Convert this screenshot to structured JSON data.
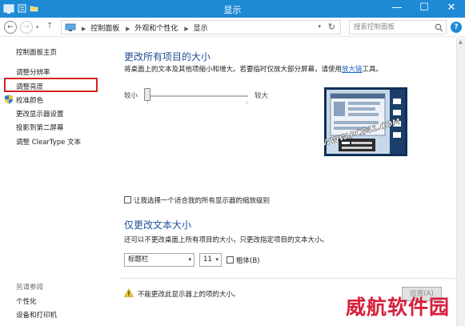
{
  "window": {
    "title": "显示",
    "minimize_glyph": "—",
    "maximize_glyph": "☐",
    "close_glyph": "✕"
  },
  "nav": {
    "back_glyph": "←",
    "forward_glyph": "→",
    "history_glyph": "▾",
    "up_glyph": "↑"
  },
  "address": {
    "crumbs": [
      "控制面板",
      "外观和个性化",
      "显示"
    ],
    "separator": "▶",
    "refresh_glyph": "↻",
    "dropdown_glyph": "▾"
  },
  "search": {
    "placeholder": "搜索控制面板"
  },
  "help": {
    "label": "?"
  },
  "sidebar": {
    "home": "控制面板主页",
    "items": [
      "调整分辨率",
      "调整亮度",
      "校准颜色",
      "更改显示器设置",
      "投影到第二屏幕",
      "调整 ClearType 文本"
    ],
    "see_also": "另请参阅",
    "related": [
      "个性化",
      "设备和打印机"
    ]
  },
  "main": {
    "heading1": "更改所有项目的大小",
    "description1_prefix": "将桌面上的文本及其他项缩小和增大。若要临时仅放大部分屏幕，请使用",
    "magnifier_link": "放大镜",
    "description1_suffix": "工具。",
    "slider": {
      "min_label": "较小",
      "max_label": "较大",
      "level": 0
    },
    "custom_scaling_label": "让我选择一个适合我的所有显示器的缩放级别",
    "heading2": "仅更改文本大小",
    "description2": "还可以不更改桌面上所有项目的大小，只更改指定项目的文本大小。",
    "item_select": {
      "value": "标题栏",
      "caret": "▾"
    },
    "size_select": {
      "value": "11",
      "caret": "▾"
    },
    "bold_label": "粗体(B)",
    "warning": "不能更改此显示器上的项的大小。",
    "apply_label": "应用(A)"
  },
  "scrollbar": {
    "up_glyph": "▲"
  },
  "watermark": {
    "overlay_text": "WWW.PC841.COM",
    "corner_text": "威航软件园"
  },
  "colors": {
    "titlebar": "#1e8ad6",
    "heading": "#1e4f96",
    "link": "#1d64c4",
    "highlight": "#d42323",
    "watermark": "#d6203c"
  }
}
